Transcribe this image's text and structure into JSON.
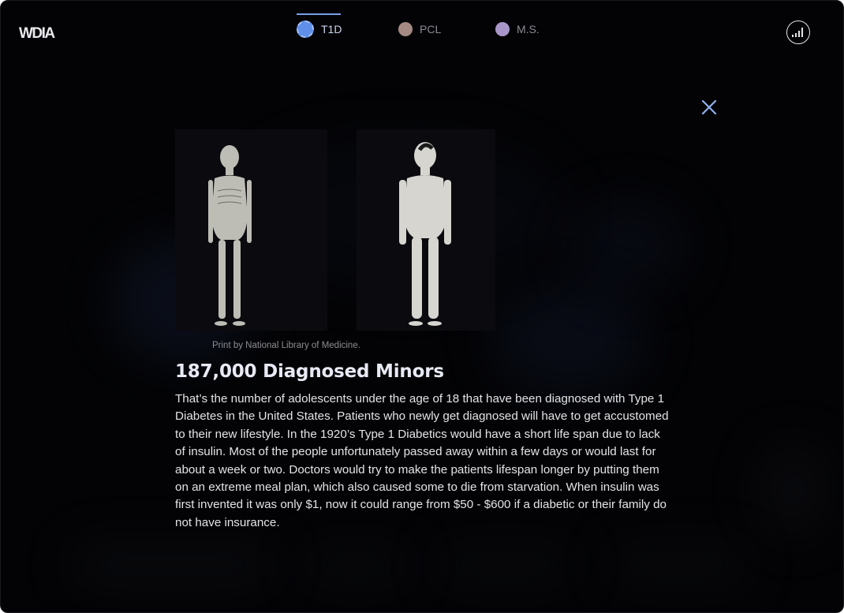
{
  "header": {
    "logo": "WDIA",
    "tabs": [
      {
        "label": "T1D",
        "color": "#5f8fe8",
        "active": true
      },
      {
        "label": "PCL",
        "color": "#a48a83",
        "active": false
      },
      {
        "label": "M.S.",
        "color": "#a896c8",
        "active": false
      }
    ],
    "signal_icon": "signal-bars-icon"
  },
  "modal": {
    "close_icon": "close-icon",
    "caption": "Print by National Library of Medicine.",
    "title": "187,000 Diagnosed Minors",
    "body": "That’s the number of adolescents under the age of 18 that have been diagnosed with Type 1 Diabetes in the United States. Patients who newly get diagnosed will have to get accustomed to their new lifestyle. In the 1920’s Type 1 Diabetics would have a short life span due to lack of insulin. Most of the people unfortunately passed away within a few days or would last for about a week or two. Doctors would try to make the patients lifespan longer by putting them on an extreme meal plan, which also caused some to die from starvation. When insulin was first invented it was only $1, now it could range from $50 - $600 if a diabetic or their family do not have insurance."
  },
  "colors": {
    "accent": "#7b9ee8",
    "background": "#030305"
  }
}
